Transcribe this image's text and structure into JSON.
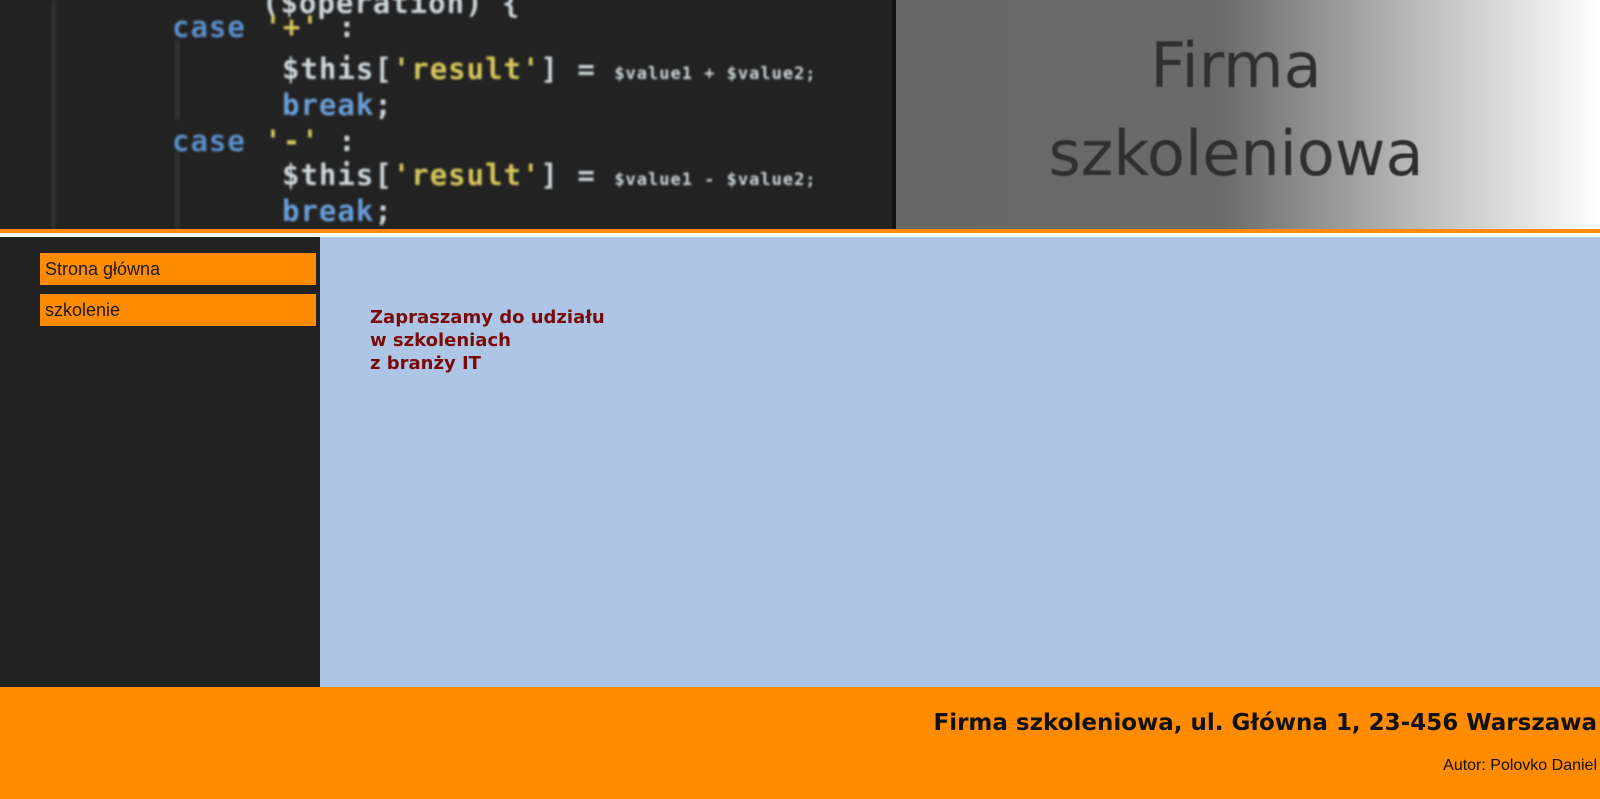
{
  "header": {
    "code_banner": {
      "lines": [
        {
          "parts": [
            {
              "cls": "c-punc",
              "text": "(",
              "key": "p0"
            },
            {
              "cls": "c-var",
              "text": "$operation",
              "key": "p1"
            },
            {
              "cls": "c-punc",
              "text": ") {",
              "key": "p2"
            }
          ]
        },
        {
          "parts": [
            {
              "cls": "c-kw",
              "text": "case",
              "key": "p0"
            },
            {
              "cls": "c-str",
              "text": " '+' ",
              "key": "p1"
            },
            {
              "cls": "c-punc",
              "text": ":",
              "key": "p2"
            }
          ]
        },
        {
          "parts": [
            {
              "cls": "c-var",
              "text": "$this",
              "key": "p0"
            },
            {
              "cls": "c-punc",
              "text": "[",
              "key": "p1"
            },
            {
              "cls": "c-str",
              "text": "'result'",
              "key": "p2"
            },
            {
              "cls": "c-punc",
              "text": "] = ",
              "key": "p3"
            },
            {
              "cls": "c-var tail",
              "text": "$value1 + $value2;",
              "key": "p4"
            }
          ]
        },
        {
          "parts": [
            {
              "cls": "c-brk",
              "text": "break",
              "key": "p0"
            },
            {
              "cls": "c-punc",
              "text": ";",
              "key": "p1"
            }
          ]
        },
        {
          "parts": [
            {
              "cls": "c-kw",
              "text": "case",
              "key": "p0"
            },
            {
              "cls": "c-str",
              "text": " '-' ",
              "key": "p1"
            },
            {
              "cls": "c-punc",
              "text": ":",
              "key": "p2"
            }
          ]
        },
        {
          "parts": [
            {
              "cls": "c-var",
              "text": "$this",
              "key": "p0"
            },
            {
              "cls": "c-punc",
              "text": "[",
              "key": "p1"
            },
            {
              "cls": "c-str",
              "text": "'result'",
              "key": "p2"
            },
            {
              "cls": "c-punc",
              "text": "] = ",
              "key": "p3"
            },
            {
              "cls": "c-var tail",
              "text": "$value1 - $value2;",
              "key": "p4"
            }
          ]
        },
        {
          "parts": [
            {
              "cls": "c-brk",
              "text": "break",
              "key": "p0"
            },
            {
              "cls": "c-punc",
              "text": ";",
              "key": "p1"
            }
          ]
        }
      ]
    },
    "title_line1": "Firma",
    "title_line2": "szkoleniowa"
  },
  "sidebar": {
    "items": [
      {
        "label": "Strona główna"
      },
      {
        "label": "szkolenie"
      }
    ]
  },
  "main": {
    "intro_line1": "Zapraszamy do udziału",
    "intro_line2": "w szkoleniach",
    "intro_line3": "z branży IT"
  },
  "footer": {
    "address": "Firma szkoleniowa, ul. Główna 1, 23-456 Warszawa",
    "author": "Autor: Polovko Daniel"
  },
  "colors": {
    "accent": "#ff8c00",
    "dark": "#222222",
    "main_bg": "#adc6e5",
    "intro_text": "#7a0a0a"
  }
}
